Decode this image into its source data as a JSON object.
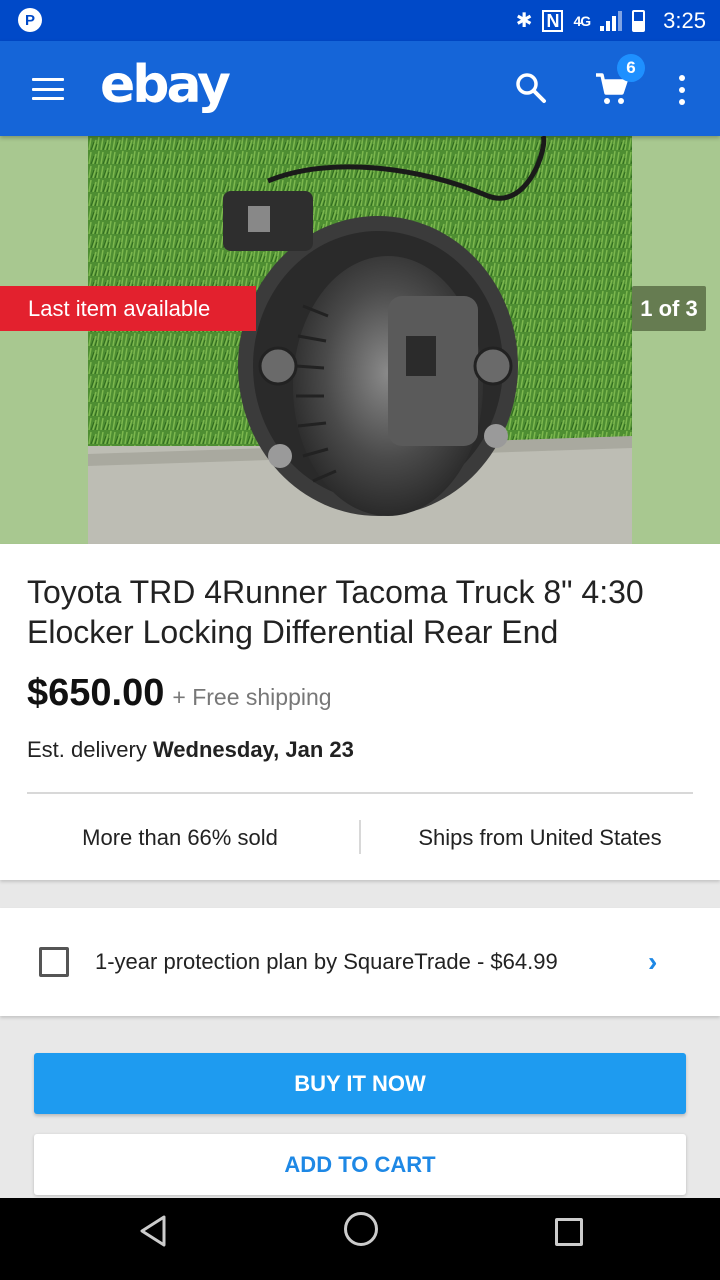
{
  "status_bar": {
    "app_icon": "P",
    "network": "4G",
    "time": "3:25",
    "icons": [
      "bluetooth-icon",
      "nfc-icon",
      "signal-icon",
      "battery-icon"
    ]
  },
  "header": {
    "logo": "ebay",
    "cart_count": "6",
    "icons": [
      "menu-icon",
      "search-icon",
      "cart-icon",
      "more-icon"
    ]
  },
  "gallery": {
    "badge": "Last item available",
    "counter": "1 of 3"
  },
  "listing": {
    "title": "Toyota TRD 4Runner Tacoma Truck 8\" 4:30 Elocker Locking Differential Rear End",
    "price": "$650.00",
    "shipping": "+ Free shipping",
    "delivery_prefix": "Est. delivery ",
    "delivery_date": "Wednesday, Jan 23",
    "sold_stat": "More than 66% sold",
    "ships_from": "Ships from United States"
  },
  "protection": {
    "label": "1-year protection plan by SquareTrade - $64.99",
    "checked": false
  },
  "actions": {
    "buy_now": "BUY IT NOW",
    "add_to_cart": "ADD TO CART"
  },
  "colors": {
    "status_bar": "#0049c8",
    "header": "#1565d8",
    "badge_red": "#e3212e",
    "buy_button": "#1e9bf0",
    "link_blue": "#1e88e5"
  }
}
